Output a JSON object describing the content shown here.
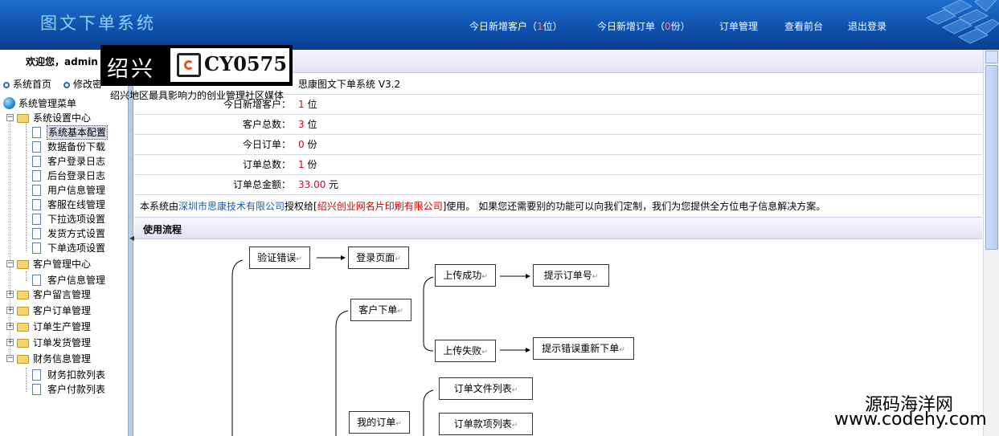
{
  "header": {
    "title": "图文下单系统",
    "nav": {
      "new_customers_prefix": "今日新增客户（",
      "new_customers_count": "1",
      "new_customers_suffix": "位）",
      "new_orders_prefix": "今日新增订单（",
      "new_orders_count": "0",
      "new_orders_suffix": "份）",
      "order_manage": "订单管理",
      "view_front": "查看前台",
      "logout": "退出登录"
    }
  },
  "logo": {
    "left_text": "绍兴",
    "brand": "CY0575",
    "tagline": "绍兴地区最具影响力的创业管理社区媒体"
  },
  "sidebar": {
    "welcome": "欢迎您，admin",
    "quick_links": [
      "系统首页",
      "修改密"
    ],
    "tree": {
      "root": "系统管理菜单",
      "groups": [
        {
          "label": "系统设置中心",
          "items": [
            "系统基本配置",
            "数据备份下载",
            "客户登录日志",
            "后台登录日志",
            "用户信息管理",
            "客服在线管理",
            "下拉选项设置",
            "发货方式设置",
            "下单选项设置"
          ]
        },
        {
          "label": "客户管理中心",
          "items": [
            "客户信息管理"
          ]
        },
        {
          "label": "客户留言管理",
          "items": []
        },
        {
          "label": "客户订单管理",
          "items": []
        },
        {
          "label": "订单生产管理",
          "items": []
        },
        {
          "label": "订单发货管理",
          "items": []
        },
        {
          "label": "财务信息管理",
          "items": [
            "财务扣款列表",
            "客户付款列表"
          ]
        }
      ],
      "selected": "系统基本配置"
    }
  },
  "main": {
    "info": {
      "version": "思康图文下单系统 V3.2",
      "rows": [
        {
          "key": "今日新增客户：",
          "value": "1",
          "unit": " 位"
        },
        {
          "key": "客户总数：",
          "value": "3",
          "unit": " 位"
        },
        {
          "key": "今日订单：",
          "value": "0",
          "unit": " 份"
        },
        {
          "key": "订单总数：",
          "value": "1",
          "unit": " 份"
        },
        {
          "key": "订单总金额：",
          "value": "33.00",
          "unit": " 元"
        }
      ]
    },
    "notice": {
      "p1": "本系统由",
      "company": "深圳市思康技术有限公司",
      "p2": "授权给[",
      "licensee": "绍兴创业网名片印刷有限公司",
      "p3": "]使用。  如果您还需要别的功能可以向我们定制，我们为您提供全方位电子信息解决方案。"
    },
    "flow": {
      "title": "使用流程",
      "boxes": {
        "verify_error": "验证错误",
        "login_page": "登录页面",
        "customer_order": "客户下单",
        "upload_ok": "上传成功",
        "show_order_no": "提示订单号",
        "upload_fail": "上传失败",
        "retry_order": "提示错误重新下单",
        "my_orders": "我的订单",
        "order_files": "订单文件列表",
        "order_payments": "订单款项列表"
      },
      "return_mark": "↵"
    }
  },
  "watermark": {
    "line1": "源码海洋网",
    "line2": "www.codehy.com"
  },
  "colors": {
    "banner": "#0f52ad",
    "highlight": "#e0002a",
    "link": "#1b5bb3"
  }
}
